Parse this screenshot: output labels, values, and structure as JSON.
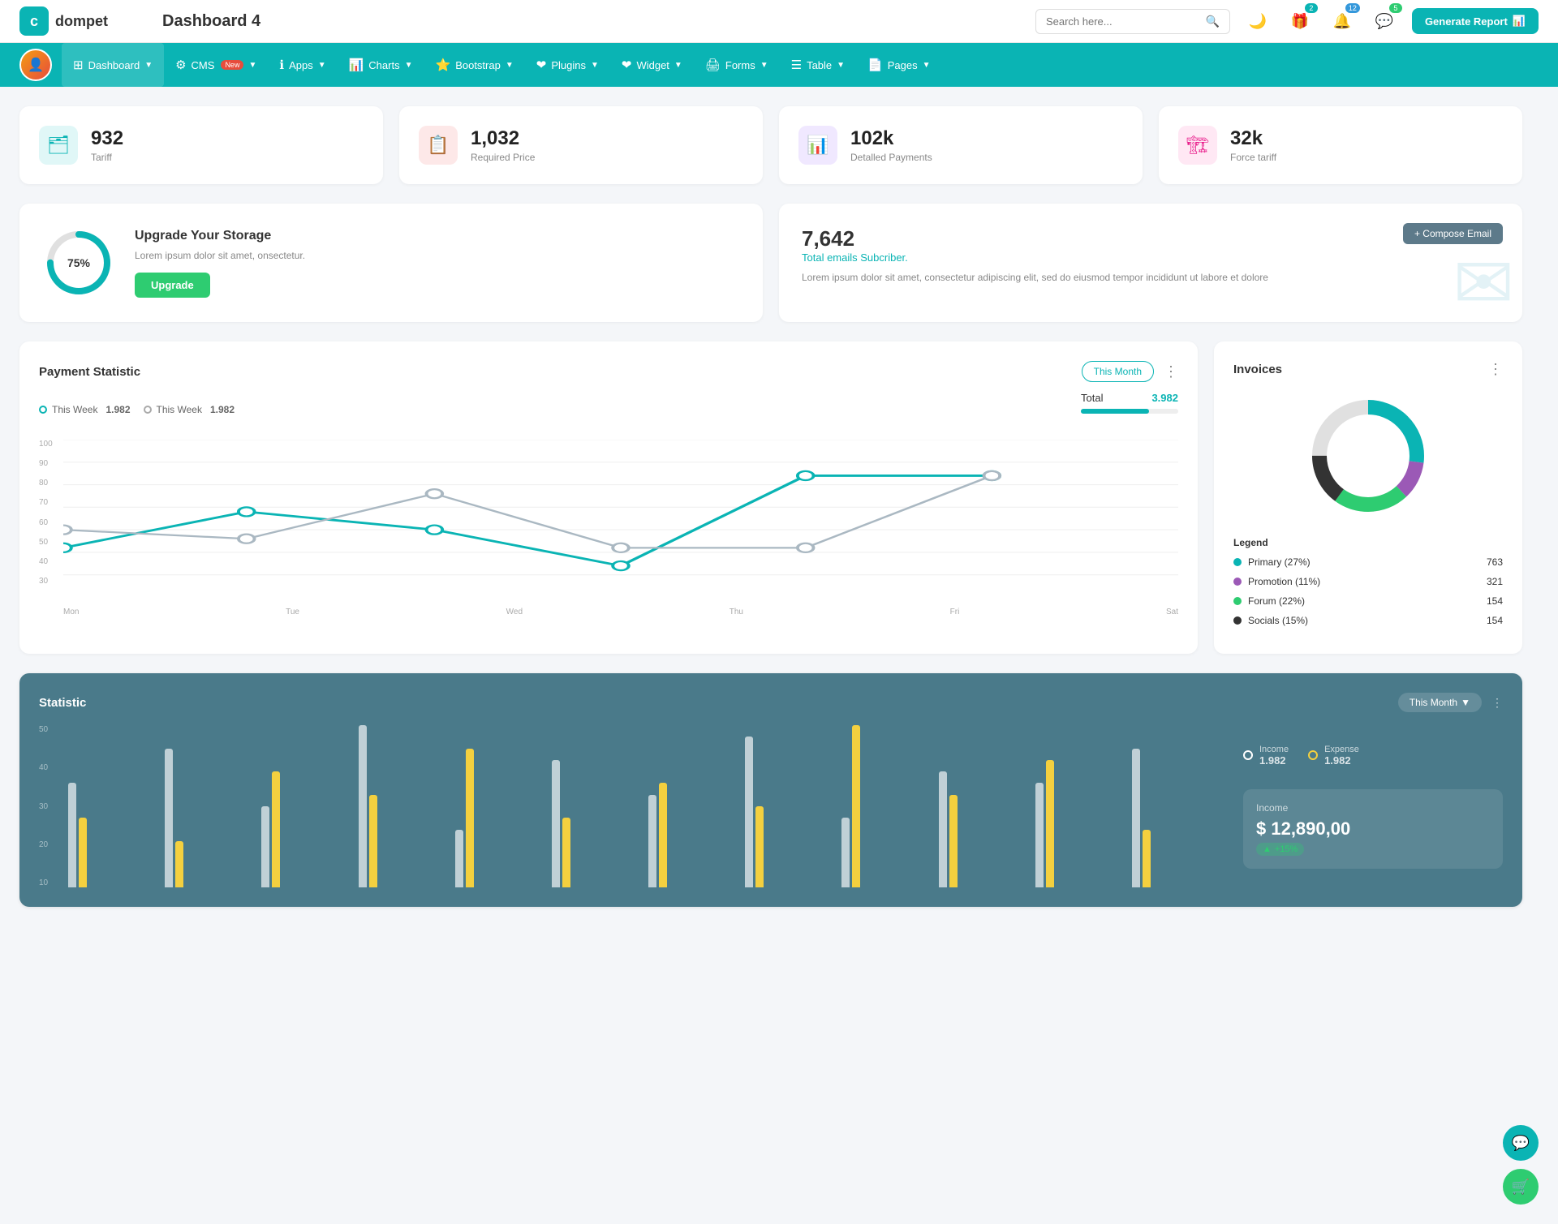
{
  "app": {
    "logo_letter": "c",
    "logo_bg": "#0ab4b4",
    "name": "dompet",
    "title": "Dashboard 4"
  },
  "search": {
    "placeholder": "Search here..."
  },
  "topbar": {
    "dark_mode_icon": "🌙",
    "gift_icon": "🎁",
    "bell_icon": "🔔",
    "chat_icon": "💬",
    "gift_badge": "2",
    "bell_badge": "12",
    "chat_badge": "5",
    "generate_btn": "Generate Report"
  },
  "navbar": {
    "items": [
      {
        "label": "Dashboard",
        "icon": "⊞",
        "active": true,
        "has_arrow": true
      },
      {
        "label": "CMS",
        "icon": "⚙",
        "active": false,
        "has_arrow": true,
        "badge": "New"
      },
      {
        "label": "Apps",
        "icon": "ℹ",
        "active": false,
        "has_arrow": true
      },
      {
        "label": "Charts",
        "icon": "📊",
        "active": false,
        "has_arrow": true
      },
      {
        "label": "Bootstrap",
        "icon": "⭐",
        "active": false,
        "has_arrow": true
      },
      {
        "label": "Plugins",
        "icon": "❤",
        "active": false,
        "has_arrow": true
      },
      {
        "label": "Widget",
        "icon": "❤",
        "active": false,
        "has_arrow": true
      },
      {
        "label": "Forms",
        "icon": "🖨",
        "active": false,
        "has_arrow": true
      },
      {
        "label": "Table",
        "icon": "☰",
        "active": false,
        "has_arrow": true
      },
      {
        "label": "Pages",
        "icon": "📄",
        "active": false,
        "has_arrow": true
      }
    ]
  },
  "stat_cards": [
    {
      "value": "932",
      "label": "Tariff",
      "icon_type": "teal",
      "icon": "🗂"
    },
    {
      "value": "1,032",
      "label": "Required Price",
      "icon_type": "red",
      "icon": "📋"
    },
    {
      "value": "102k",
      "label": "Detalled Payments",
      "icon_type": "purple",
      "icon": "📊"
    },
    {
      "value": "32k",
      "label": "Force tariff",
      "icon_type": "pink",
      "icon": "🏗"
    }
  ],
  "upgrade": {
    "percent": "75%",
    "percent_num": 75,
    "title": "Upgrade Your Storage",
    "description": "Lorem ipsum dolor sit amet, onsectetur.",
    "button": "Upgrade"
  },
  "email": {
    "count": "7,642",
    "subtitle": "Total emails Subcriber.",
    "description": "Lorem ipsum dolor sit amet, consectetur adipiscing elit, sed do eiusmod tempor incididunt ut labore et dolore",
    "compose_btn": "+ Compose Email"
  },
  "payment": {
    "title": "Payment Statistic",
    "legend1_label": "This Week",
    "legend1_value": "1.982",
    "legend2_label": "This Week",
    "legend2_value": "1.982",
    "filter_btn": "This Month",
    "total_label": "Total",
    "total_value": "3.982",
    "y_labels": [
      "100",
      "90",
      "80",
      "70",
      "60",
      "50",
      "40",
      "30"
    ],
    "x_labels": [
      "Mon",
      "Tue",
      "Wed",
      "Thu",
      "Fri",
      "Sat"
    ]
  },
  "invoices": {
    "title": "Invoices",
    "donut": {
      "segments": [
        {
          "label": "Primary (27%)",
          "color": "#0ab4b4",
          "value": 27,
          "count": "763"
        },
        {
          "label": "Promotion (11%)",
          "color": "#9b59b6",
          "value": 11,
          "count": "321"
        },
        {
          "label": "Forum (22%)",
          "color": "#2ecc71",
          "value": 22,
          "count": "154"
        },
        {
          "label": "Socials (15%)",
          "color": "#333",
          "value": 15,
          "count": "154"
        }
      ]
    },
    "legend_title": "Legend"
  },
  "statistic": {
    "title": "Statistic",
    "filter_btn": "This Month",
    "income_label": "Income",
    "income_value": "1.982",
    "expense_label": "Expense",
    "expense_value": "1.982",
    "income_panel_label": "Income",
    "income_amount": "$ 12,890,00",
    "income_badge": "+15%",
    "y_labels": [
      "50",
      "40",
      "30",
      "20",
      "10"
    ],
    "bars": [
      {
        "white": 45,
        "yellow": 30
      },
      {
        "white": 60,
        "yellow": 20
      },
      {
        "white": 35,
        "yellow": 50
      },
      {
        "white": 70,
        "yellow": 40
      },
      {
        "white": 25,
        "yellow": 60
      },
      {
        "white": 55,
        "yellow": 30
      },
      {
        "white": 40,
        "yellow": 45
      },
      {
        "white": 65,
        "yellow": 35
      },
      {
        "white": 30,
        "yellow": 70
      },
      {
        "white": 50,
        "yellow": 40
      },
      {
        "white": 45,
        "yellow": 55
      },
      {
        "white": 60,
        "yellow": 25
      }
    ]
  },
  "float_btns": {
    "chat_icon": "💬",
    "cart_icon": "🛒"
  }
}
